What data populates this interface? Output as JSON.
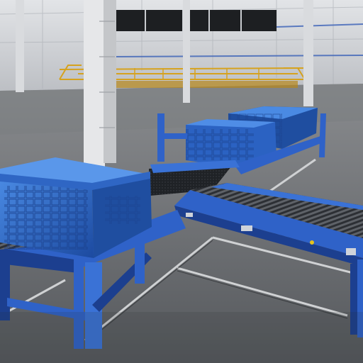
{
  "scene": {
    "subject": "warehouse-conveyor-system",
    "colors": {
      "conveyor_blue": "#2f62c8",
      "conveyor_dark": "#1c3f8f",
      "crate_blue": "#3a78d6",
      "crate_dark": "#1f4ea0",
      "floor": "#6d6f72",
      "wall": "#c9ccd0",
      "railing_yellow": "#d6a21e",
      "column_white": "#e6e7e9",
      "roller_gray": "#4a4d52"
    },
    "objects": [
      "warehouse-wall",
      "window-band",
      "yellow-mezzanine-railing",
      "steel-column",
      "concrete-floor",
      "floor-rail-track",
      "roller-conveyor-main",
      "roller-conveyor-branch",
      "belt-conveyor-segment",
      "blue-storage-crate-large",
      "blue-storage-crate-stack"
    ]
  }
}
